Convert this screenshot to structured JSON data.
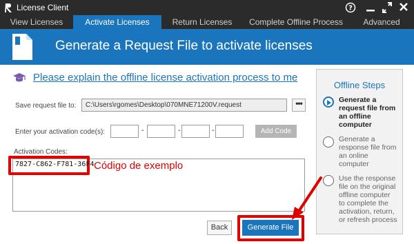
{
  "window": {
    "title": "License Client",
    "help_glyph": "?",
    "icons": [
      "app-icon",
      "help-icon",
      "minimize-icon",
      "expand-icon",
      "close-icon"
    ]
  },
  "tabs": [
    {
      "label": "View Licenses",
      "active": false
    },
    {
      "label": "Activate Licenses",
      "active": true
    },
    {
      "label": "Return Licenses",
      "active": false
    },
    {
      "label": "Complete Offline Process",
      "active": false
    },
    {
      "label": "Advanced",
      "active": false
    }
  ],
  "banner": {
    "title": "Generate a Request File to activate licenses",
    "icon": "document-icon"
  },
  "help": {
    "link_text": "Please explain the offline license activation process to me",
    "icon": "graduation-cap-icon"
  },
  "form": {
    "save_label": "Save request file to:",
    "save_path": "C:\\Users\\rgomes\\Desktop\\070MNE71200V.request",
    "browse_label": "•••",
    "code_label": "Enter your activation code(s):",
    "code_values": [
      "",
      "",
      "",
      ""
    ],
    "code_separator": "-",
    "add_code_label": "Add Code",
    "codes_label": "Activation Codes:",
    "codes_value": "7827-C862-F781-36F4",
    "annotation": "Código de exemplo"
  },
  "buttons": {
    "back": "Back",
    "generate": "Generate File"
  },
  "steps": {
    "title": "Offline Steps",
    "items": [
      {
        "text": "Generate a request file from an offline computer",
        "active": true
      },
      {
        "text": "Generate a response file from an online computer",
        "active": false
      },
      {
        "text": "Use the response file on the original offline computer to complete the activation, return, or refresh process",
        "active": false
      }
    ]
  },
  "colors": {
    "accent": "#1b75bc",
    "titlebar": "#2b2b2b",
    "highlight": "#e00000",
    "panel": "#f2f2f2"
  }
}
